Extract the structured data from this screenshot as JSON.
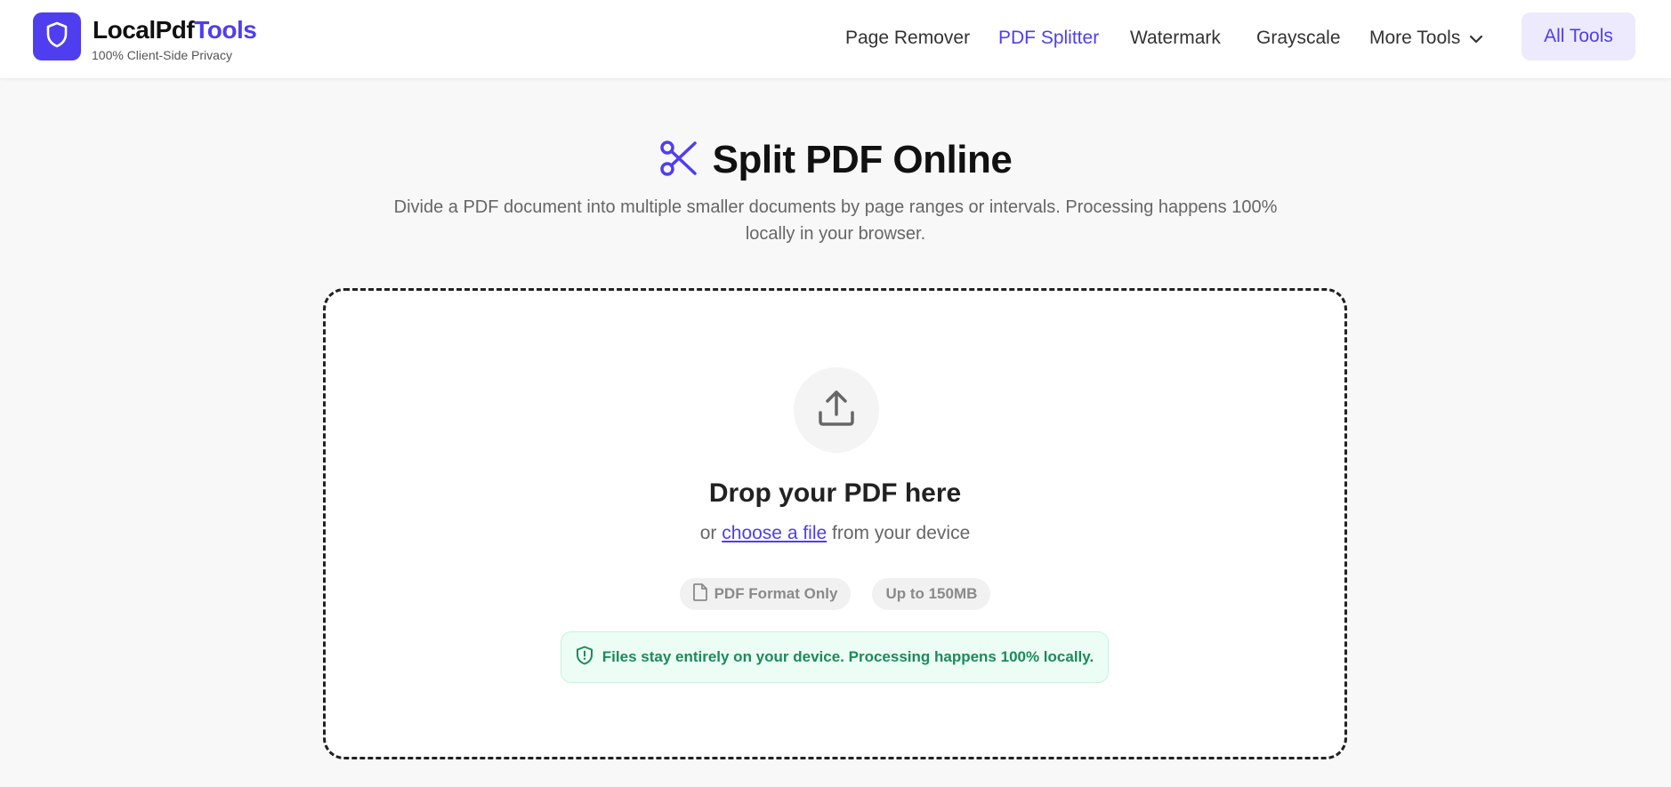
{
  "brand": {
    "name_part1": "LocalPdf",
    "name_part2": "Tools",
    "tagline": "100% Client-Side Privacy",
    "accent_color": "#4f3ef0",
    "logo_icon": "shield-icon"
  },
  "nav": {
    "items": [
      {
        "label": "Page Remover",
        "active": false
      },
      {
        "label": "PDF Splitter",
        "active": true
      },
      {
        "label": "Watermark",
        "active": false
      },
      {
        "label": "Grayscale",
        "active": false
      }
    ],
    "more_label": "More Tools",
    "more_icon": "chevron-down-icon",
    "all_tools_label": "All Tools"
  },
  "hero": {
    "icon": "scissors-icon",
    "title": "Split PDF Online",
    "description": "Divide a PDF document into multiple smaller documents by page ranges or intervals. Processing happens 100% locally in your browser."
  },
  "dropzone": {
    "icon": "upload-icon",
    "title": "Drop your PDF here",
    "sub_prefix": "or",
    "choose_link": "choose a file",
    "sub_suffix": "from your device",
    "badges": [
      {
        "label": "PDF Format Only",
        "icon": "file-icon"
      },
      {
        "label": "Up to 150MB",
        "icon": ""
      }
    ],
    "privacy_note": "Files stay entirely on your device. Processing happens 100% locally.",
    "privacy_icon": "shield-alert-icon",
    "privacy_color": "#1d8a5a"
  }
}
